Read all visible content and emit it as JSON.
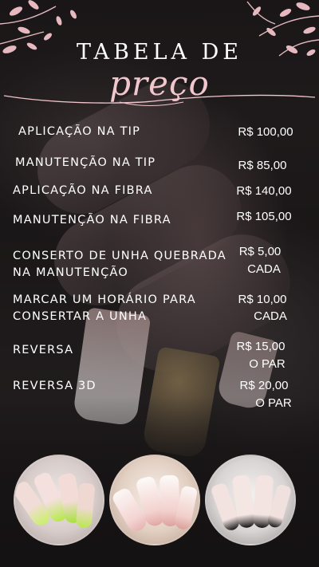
{
  "header": {
    "title": "TABELA DE",
    "script_title": "preço"
  },
  "services": [
    {
      "name": [
        "APLICAÇÃO NA TIP"
      ],
      "price": [
        "R$ 100,00"
      ]
    },
    {
      "name": [
        "MANUTENÇÃO NA TIP"
      ],
      "price": [
        "R$ 85,00"
      ]
    },
    {
      "name": [
        "APLICAÇÃO NA FIBRA"
      ],
      "price": [
        "R$ 140,00"
      ]
    },
    {
      "name": [
        "MANUTENÇÃO NA FIBRA"
      ],
      "price": [
        "R$ 105,00"
      ]
    },
    {
      "name": [
        "CONSERTO DE UNHA QUEBRADA",
        "NA MANUTENÇÃO"
      ],
      "price": [
        "R$ 5,00",
        "CADA"
      ]
    },
    {
      "name": [
        "MARCAR UM HORÁRIO PARA",
        "CONSERTAR A UNHA"
      ],
      "price": [
        "R$ 10,00",
        "CADA"
      ]
    },
    {
      "name": [
        "REVERSA"
      ],
      "price": [
        "R$ 15,00",
        "O PAR"
      ]
    },
    {
      "name": [
        "REVERSA 3D"
      ],
      "price": [
        "R$ 20,00",
        "O PAR"
      ]
    }
  ],
  "photos": [
    {
      "icon": "neon-green-french-nails-photo"
    },
    {
      "icon": "pink-white-ombre-nails-photo"
    },
    {
      "icon": "black-french-nails-photo"
    }
  ],
  "colors": {
    "accent_pink": "#f1c6cd",
    "text": "#ffffff",
    "background": "#1e1a1b"
  }
}
